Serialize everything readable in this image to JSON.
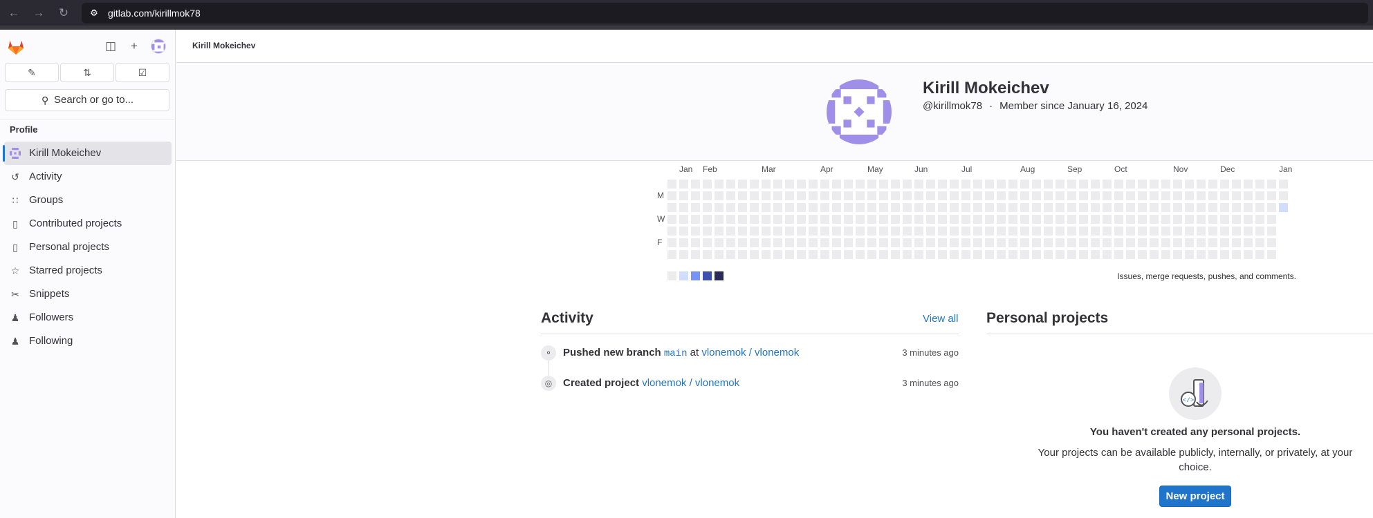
{
  "browser": {
    "url": "gitlab.com/kirillmok78",
    "icons": [
      "back-arrow-icon",
      "forward-arrow-icon",
      "reload-icon",
      "site-settings-icon"
    ]
  },
  "sidebar": {
    "quick_buttons": [
      {
        "name": "issues-button",
        "icon": "issues-icon"
      },
      {
        "name": "merge-requests-button",
        "icon": "merge-request-icon"
      },
      {
        "name": "todos-button",
        "icon": "todo-icon"
      }
    ],
    "search_label": "Search or go to...",
    "section_label": "Profile",
    "items": [
      {
        "label": "Kirill Mokeichev",
        "icon": "avatar-icon",
        "active": true
      },
      {
        "label": "Activity",
        "icon": "history-icon"
      },
      {
        "label": "Groups",
        "icon": "group-icon"
      },
      {
        "label": "Contributed projects",
        "icon": "project-icon"
      },
      {
        "label": "Personal projects",
        "icon": "project-icon"
      },
      {
        "label": "Starred projects",
        "icon": "star-icon"
      },
      {
        "label": "Snippets",
        "icon": "snippet-icon"
      },
      {
        "label": "Followers",
        "icon": "users-icon"
      },
      {
        "label": "Following",
        "icon": "users-icon"
      }
    ]
  },
  "breadcrumb": "Kirill Mokeichev",
  "profile": {
    "name": "Kirill Mokeichev",
    "username": "@kirillmok78",
    "member_since": "Member since January 16, 2024"
  },
  "calendar": {
    "months": [
      "Jan",
      "Feb",
      "Mar",
      "Apr",
      "May",
      "Jun",
      "Jul",
      "Aug",
      "Sep",
      "Oct",
      "Nov",
      "Dec",
      "Jan"
    ],
    "day_labels": [
      "M",
      "W",
      "F"
    ],
    "legend_text": "Issues, merge requests, pushes, and comments.",
    "legend_colors": [
      "#ececef",
      "#d2dcff",
      "#7992f5",
      "#3f51ae",
      "#2a2b59"
    ],
    "highlight_color": "#d2dcff"
  },
  "activity": {
    "title": "Activity",
    "view_all": "View all",
    "events": [
      {
        "icon": "commit-icon",
        "action": "Pushed new branch",
        "branch": "main",
        "connector": "at",
        "project": "vlonemok / vlonemok",
        "time": "3 minutes ago"
      },
      {
        "icon": "project-created-icon",
        "action": "Created project",
        "project": "vlonemok / vlonemok",
        "time": "3 minutes ago"
      }
    ]
  },
  "personal_projects": {
    "title": "Personal projects",
    "empty_title": "You haven't created any personal projects.",
    "empty_description": "Your projects can be available publicly, internally, or privately, at your choice.",
    "new_button": "New project"
  },
  "colors": {
    "link": "#1f75cb",
    "primary_button": "#1f75cb",
    "avatar_identicon": "#a08fe8"
  }
}
